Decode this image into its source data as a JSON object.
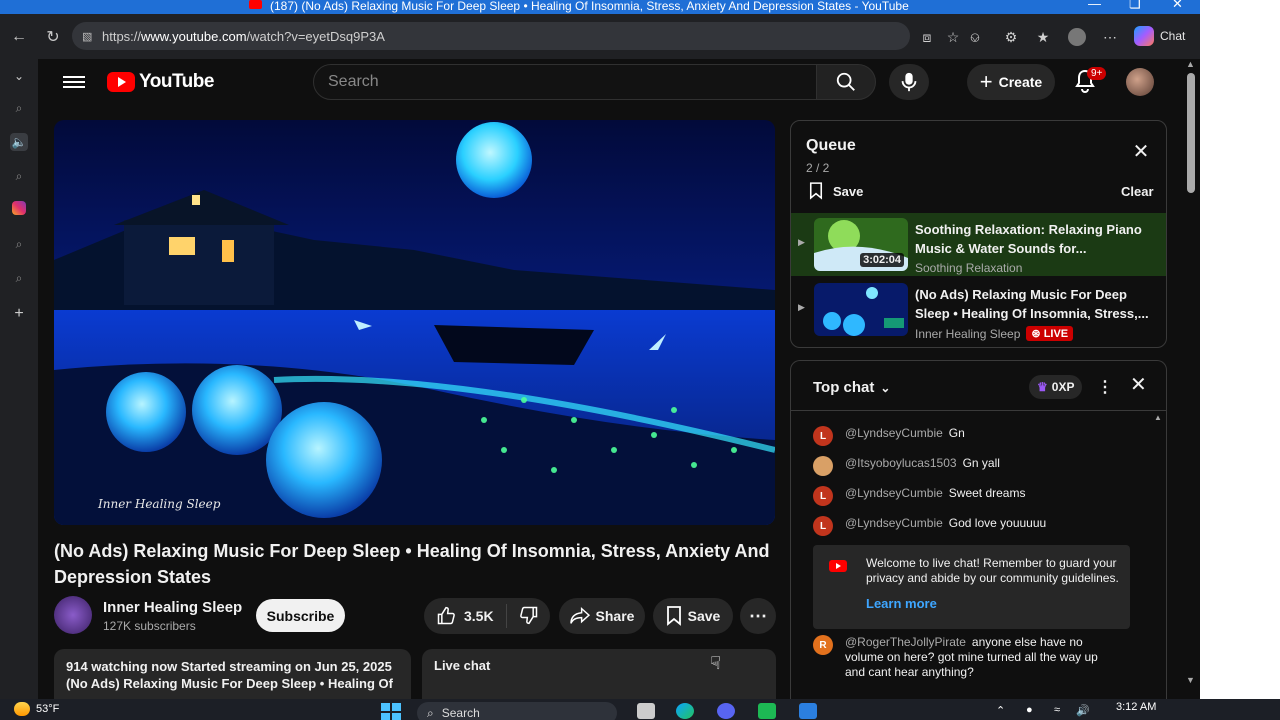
{
  "window": {
    "title": "(187) (No Ads) Relaxing Music For Deep Sleep • Healing Of Insomnia, Stress, Anxiety And Depression States - YouTube"
  },
  "browser": {
    "url_prefix": "https://",
    "url_host": "www.youtube.com",
    "url_path": "/watch?v=eyetDsq9P3A",
    "chat_label": "Chat"
  },
  "masthead": {
    "logo_text": "YouTube",
    "search_placeholder": "Search",
    "create_label": "Create",
    "notifications_badge": "9+"
  },
  "video": {
    "title": "(No Ads) Relaxing Music For Deep Sleep • Healing Of Insomnia, Stress, Anxiety And Depression States",
    "player_watermark": "Inner Healing Sleep",
    "channel": {
      "name": "Inner Healing Sleep",
      "subscribers": "127K subscribers",
      "subscribe_label": "Subscribe"
    },
    "actions": {
      "likes": "3.5K",
      "share": "Share",
      "save": "Save"
    },
    "description": {
      "line1": "914 watching now  Started streaming on Jun 25, 2025",
      "line2": "(No Ads) Relaxing Music For Deep Sleep • Healing Of"
    },
    "live_chat_replay": "Live chat"
  },
  "queue": {
    "title": "Queue",
    "count": "2 / 2",
    "save_label": "Save",
    "clear_label": "Clear",
    "items": [
      {
        "title": "Soothing Relaxation: Relaxing Piano Music & Water Sounds for...",
        "channel": "Soothing Relaxation",
        "duration": "3:02:04"
      },
      {
        "title": "(No Ads) Relaxing Music For Deep Sleep • Healing Of Insomnia, Stress,...",
        "channel": "Inner Healing Sleep",
        "live_badge": "LIVE"
      }
    ]
  },
  "chat": {
    "mode": "Top chat",
    "xp": "0XP",
    "messages": [
      {
        "initial": "L",
        "author": "@LyndseyCumbie",
        "text": "Gn",
        "color": "#c1351d"
      },
      {
        "initial": "",
        "author": "@Itsyoboylucas1503",
        "text": "Gn yall",
        "color": "#d9a066"
      },
      {
        "initial": "L",
        "author": "@LyndseyCumbie",
        "text": "Sweet dreams",
        "color": "#c1351d"
      },
      {
        "initial": "L",
        "author": "@LyndseyCumbie",
        "text": "God love youuuuu",
        "color": "#c1351d"
      },
      {
        "initial": "R",
        "author": "@RogerTheJollyPirate",
        "text": "anyone else have no volume on here? got mine turned all the way up and cant hear anything?",
        "color": "#e2711d"
      }
    ],
    "welcome": {
      "text": "Welcome to live chat! Remember to guard your privacy and abide by our community guidelines.",
      "learn_more": "Learn more"
    }
  },
  "taskbar": {
    "temperature": "53°F",
    "search_label": "Search",
    "time": "3:12 AM"
  }
}
